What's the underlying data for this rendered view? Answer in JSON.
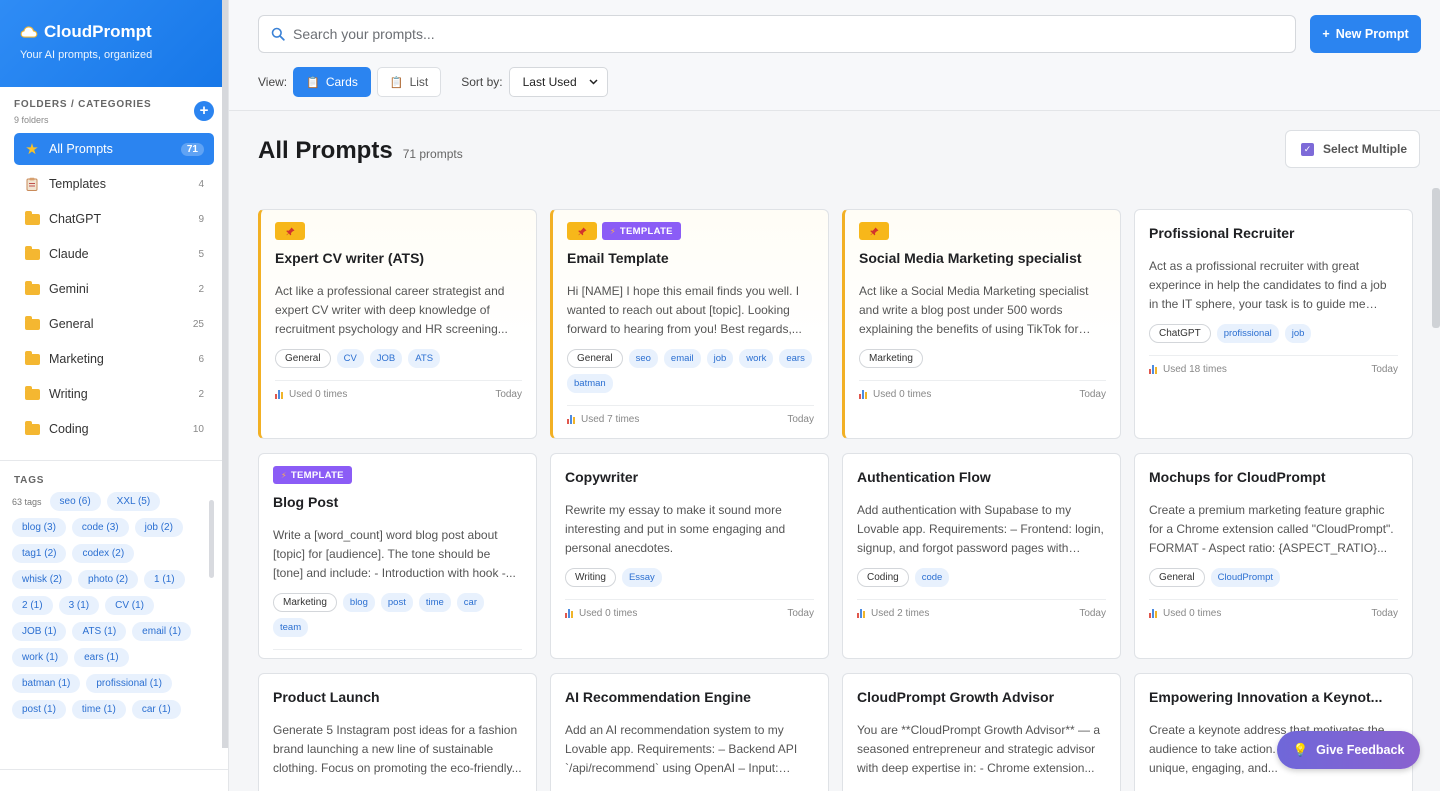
{
  "brand": {
    "title": "CloudPrompt",
    "subtitle": "Your AI prompts, organized"
  },
  "folders": {
    "label": "FOLDERS / CATEGORIES",
    "sub": "9 folders",
    "add": "+",
    "items": [
      {
        "name": "All Prompts",
        "count": "71",
        "icon": "star-icon",
        "active": true
      },
      {
        "name": "Templates",
        "count": "4",
        "icon": "clipboard-icon"
      },
      {
        "name": "ChatGPT",
        "count": "9",
        "icon": "folder-icon"
      },
      {
        "name": "Claude",
        "count": "5",
        "icon": "folder-icon"
      },
      {
        "name": "Gemini",
        "count": "2",
        "icon": "folder-icon"
      },
      {
        "name": "General",
        "count": "25",
        "icon": "folder-icon"
      },
      {
        "name": "Marketing",
        "count": "6",
        "icon": "folder-icon"
      },
      {
        "name": "Writing",
        "count": "2",
        "icon": "folder-icon"
      },
      {
        "name": "Coding",
        "count": "10",
        "icon": "folder-icon"
      }
    ]
  },
  "tags": {
    "label": "TAGS",
    "count": "63 tags",
    "items": [
      "seo (6)",
      "XXL (5)",
      "blog (3)",
      "code (3)",
      "job (2)",
      "tag1 (2)",
      "codex (2)",
      "whisk (2)",
      "photo (2)",
      "1 (1)",
      "2 (1)",
      "3 (1)",
      "CV (1)",
      "JOB (1)",
      "ATS (1)",
      "email (1)",
      "work (1)",
      "ears (1)",
      "batman (1)",
      "profissional (1)",
      "post (1)",
      "time (1)",
      "car (1)"
    ]
  },
  "search": {
    "placeholder": "Search your prompts..."
  },
  "toolbar": {
    "new_prompt": "New Prompt",
    "view_label": "View:",
    "cards": "Cards",
    "list": "List",
    "sort_label": "Sort by:",
    "sort_value": "Last Used"
  },
  "header": {
    "title": "All Prompts",
    "count": "71 prompts",
    "select_multiple": "Select Multiple"
  },
  "template_label": "TEMPLATE",
  "cards": [
    {
      "title": "Expert CV writer (ATS)",
      "pinned": true,
      "template": false,
      "desc": "Act like a professional career strategist and expert CV writer with deep knowledge of recruitment psychology and HR screening...",
      "cat": "General",
      "tags": [
        "CV",
        "JOB",
        "ATS"
      ],
      "used": "Used 0 times",
      "when": "Today"
    },
    {
      "title": "Email Template",
      "pinned": true,
      "template": true,
      "desc": "Hi [NAME] I hope this email finds you well. I wanted to reach out about [topic]. Looking forward to hearing from you! Best regards,...",
      "cat": "General",
      "tags": [
        "seo",
        "email",
        "job",
        "work",
        "ears",
        "batman"
      ],
      "used": "Used 7 times",
      "when": "Today"
    },
    {
      "title": "Social Media Marketing specialist",
      "pinned": true,
      "template": false,
      "desc": "Act like a Social Media Marketing specialist and write a blog post under 500 words explaining the benefits of using TikTok for raising brand...",
      "cat": "Marketing",
      "tags": [],
      "used": "Used 0 times",
      "when": "Today"
    },
    {
      "title": "Profissional Recruiter",
      "pinned": false,
      "template": false,
      "desc": "Act as a profissional recruiter with great experince in help the candidates to find a job in the IT sphere, your task is to guide me throug...",
      "cat": "ChatGPT",
      "tags": [
        "profissional",
        "job"
      ],
      "used": "Used 18 times",
      "when": "Today"
    },
    {
      "title": "Blog Post",
      "pinned": false,
      "template": true,
      "desc": "Write a [word_count] word blog post about [topic] for [audience]. The tone should be [tone] and include: - Introduction with hook -...",
      "cat": "Marketing",
      "tags": [
        "blog",
        "post",
        "time",
        "car",
        "team"
      ],
      "used": "Used 0 times",
      "when": "Today"
    },
    {
      "title": "Copywriter",
      "pinned": false,
      "template": false,
      "desc": "Rewrite my essay to make it sound more interesting and put in some engaging and personal anecdotes.",
      "cat": "Writing",
      "tags": [
        "Essay"
      ],
      "used": "Used 0 times",
      "when": "Today"
    },
    {
      "title": "Authentication Flow",
      "pinned": false,
      "template": false,
      "desc": "Add authentication with Supabase to my Lovable app. Requirements: – Frontend: login, signup, and forgot password pages with clean...",
      "cat": "Coding",
      "tags": [
        "code"
      ],
      "used": "Used 2 times",
      "when": "Today"
    },
    {
      "title": "Mochups for CloudPrompt",
      "pinned": false,
      "template": false,
      "desc": "Create a premium marketing feature graphic for a Chrome extension called \"CloudPrompt\". FORMAT - Aspect ratio: {ASPECT_RATIO}...",
      "cat": "General",
      "tags": [
        "CloudPrompt"
      ],
      "used": "Used 0 times",
      "when": "Today"
    },
    {
      "title": "Product Launch",
      "pinned": false,
      "template": false,
      "desc": "Generate 5 Instagram post ideas for a fashion brand launching a new line of sustainable clothing. Focus on promoting the eco-friendly...",
      "cat": "",
      "tags": [],
      "used": "",
      "when": ""
    },
    {
      "title": "AI Recommendation Engine",
      "pinned": false,
      "template": false,
      "desc": "Add an AI recommendation system to my Lovable app. Requirements: – Backend API `/api/recommend` using OpenAI – Input: user...",
      "cat": "",
      "tags": [],
      "used": "",
      "when": ""
    },
    {
      "title": "CloudPrompt Growth Advisor",
      "pinned": false,
      "template": false,
      "desc": "You are **CloudPrompt Growth Advisor** — a seasoned entrepreneur and strategic advisor with deep expertise in: - Chrome extension...",
      "cat": "",
      "tags": [],
      "used": "",
      "when": ""
    },
    {
      "title": "Empowering Innovation a Keynot...",
      "pinned": false,
      "template": false,
      "desc": "Create a keynote address that motivates the audience to take action. The speech should be unique, engaging, and...",
      "cat": "",
      "tags": [],
      "used": "",
      "when": ""
    }
  ],
  "feedback": {
    "label": "Give Feedback"
  }
}
